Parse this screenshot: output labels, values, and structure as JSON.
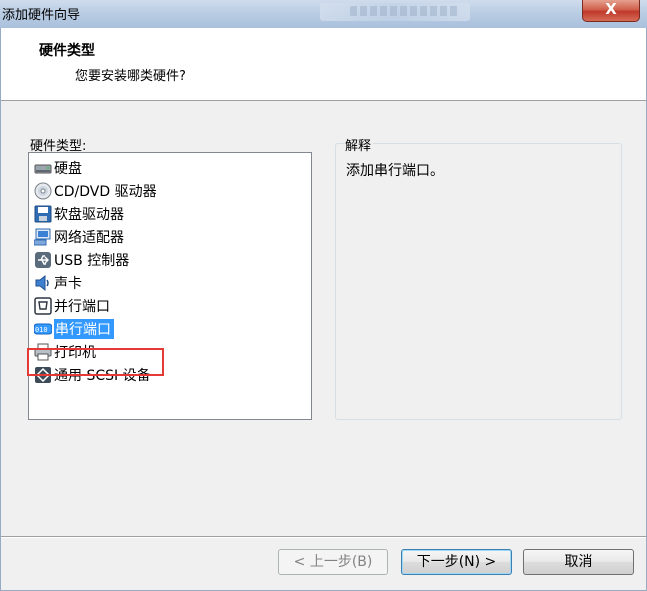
{
  "window": {
    "title": "添加硬件向导",
    "close_label": "X"
  },
  "header": {
    "title": "硬件类型",
    "subtitle": "您要安装哪类硬件?"
  },
  "hardware_list": {
    "label": "硬件类型:",
    "items": [
      {
        "label": "硬盘",
        "icon": "hard-disk-icon"
      },
      {
        "label": "CD/DVD 驱动器",
        "icon": "cd-dvd-icon"
      },
      {
        "label": "软盘驱动器",
        "icon": "floppy-icon"
      },
      {
        "label": "网络适配器",
        "icon": "network-adapter-icon"
      },
      {
        "label": "USB 控制器",
        "icon": "usb-icon"
      },
      {
        "label": "声卡",
        "icon": "sound-card-icon"
      },
      {
        "label": "并行端口",
        "icon": "parallel-port-icon"
      },
      {
        "label": "串行端口",
        "icon": "serial-port-icon",
        "selected": true
      },
      {
        "label": "打印机",
        "icon": "printer-icon"
      },
      {
        "label": "通用 SCSI 设备",
        "icon": "scsi-icon"
      }
    ]
  },
  "description": {
    "label": "解释",
    "text": "添加串行端口。"
  },
  "buttons": {
    "back": "< 上一步(B)",
    "next": "下一步(N) >",
    "cancel": "取消"
  },
  "colors": {
    "selection": "#3399ff",
    "highlight_box": "#e53935"
  }
}
